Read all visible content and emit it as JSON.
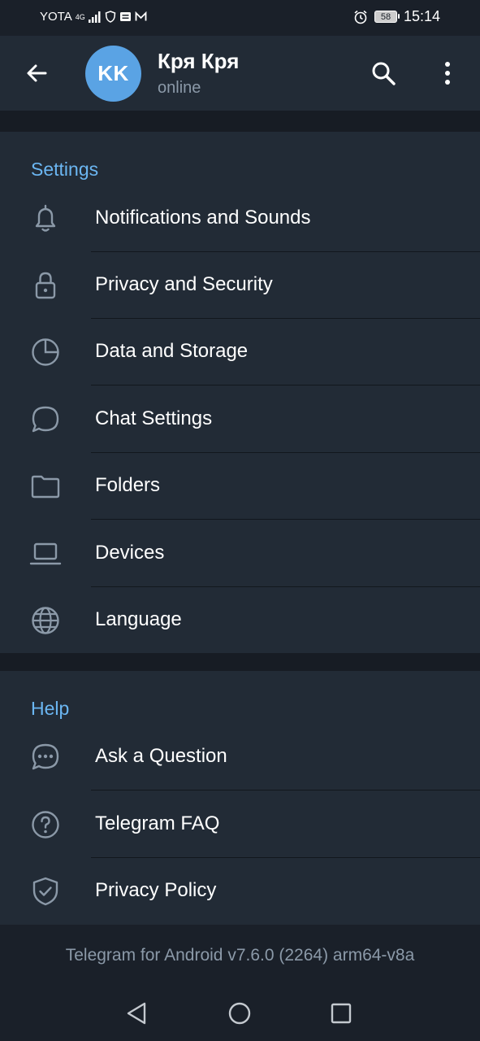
{
  "status_bar": {
    "carrier": "YOTA",
    "network": "4G",
    "battery": "58",
    "time": "15:14"
  },
  "header": {
    "avatar_initials": "KK",
    "name": "Кря Кря",
    "status": "online"
  },
  "settings": {
    "title": "Settings",
    "items": [
      {
        "label": "Notifications and Sounds",
        "icon": "bell-icon"
      },
      {
        "label": "Privacy and Security",
        "icon": "lock-icon"
      },
      {
        "label": "Data and Storage",
        "icon": "pie-chart-icon"
      },
      {
        "label": "Chat Settings",
        "icon": "chat-bubble-icon"
      },
      {
        "label": "Folders",
        "icon": "folder-icon"
      },
      {
        "label": "Devices",
        "icon": "laptop-icon"
      },
      {
        "label": "Language",
        "icon": "globe-icon"
      }
    ]
  },
  "help": {
    "title": "Help",
    "items": [
      {
        "label": "Ask a Question",
        "icon": "chat-dots-icon"
      },
      {
        "label": "Telegram FAQ",
        "icon": "question-circle-icon"
      },
      {
        "label": "Privacy Policy",
        "icon": "shield-check-icon"
      }
    ]
  },
  "footer": {
    "version": "Telegram for Android v7.6.0 (2264) arm64-v8a"
  },
  "colors": {
    "accent": "#6bb6f2",
    "avatar": "#5aa3e4",
    "background": "#1a2029",
    "panel": "#222b36"
  }
}
